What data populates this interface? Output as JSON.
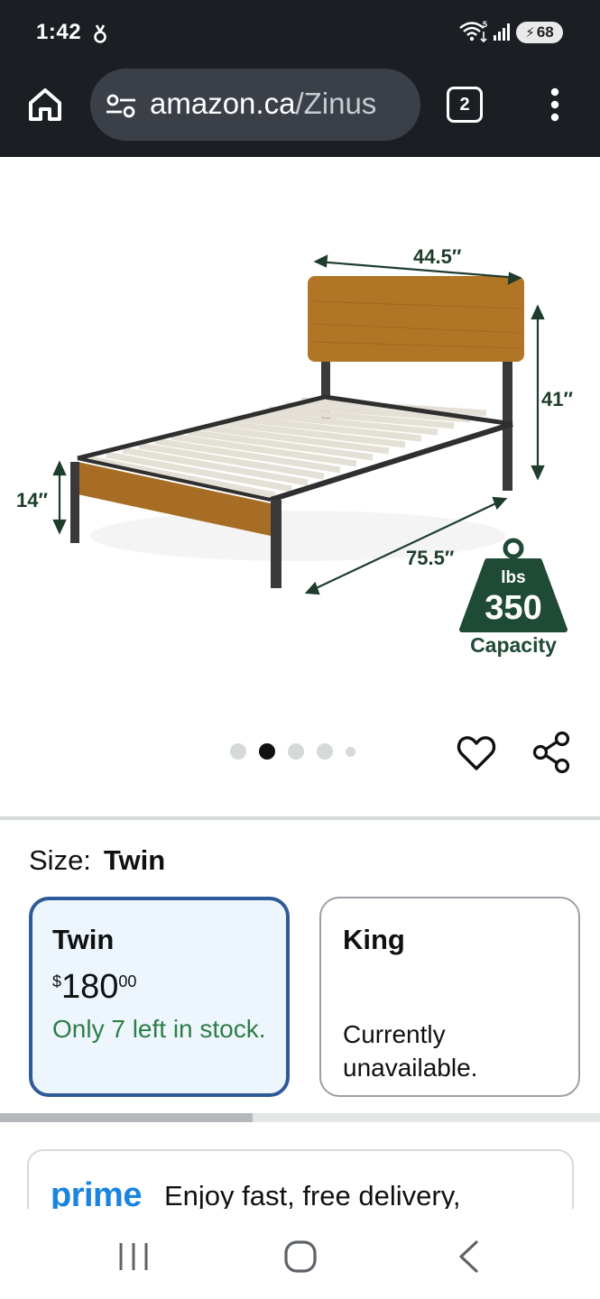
{
  "status_bar": {
    "time": "1:42",
    "battery": "68",
    "icons": [
      "notification-icon",
      "wifi-icon",
      "signal-icon",
      "battery-icon"
    ]
  },
  "browser": {
    "url_domain": "amazon.ca",
    "url_path": "/Zinus",
    "tab_count": "2",
    "icons": [
      "home-icon",
      "site-settings-icon",
      "tab-switcher-icon",
      "more-vert-icon"
    ]
  },
  "product_image": {
    "dim_width": "44.5″",
    "dim_height": "41″",
    "dim_clearance": "14″",
    "dim_length": "75.5″",
    "capacity_unit": "lbs",
    "capacity_value": "350",
    "capacity_label": "Capacity",
    "image_count": 5,
    "active_image": 2
  },
  "actions": {
    "icons": [
      "heart-icon",
      "share-icon"
    ]
  },
  "size_selector": {
    "label": "Size:",
    "selected_value": "Twin",
    "options": [
      {
        "name": "Twin",
        "currency_symbol": "$",
        "price_whole": "180",
        "price_fraction": "00",
        "stock": "Only 7 left in stock."
      },
      {
        "name": "King",
        "availability": "Currently unavailable."
      }
    ]
  },
  "prime": {
    "logo": "prime",
    "text": "Enjoy fast, free delivery,"
  },
  "colors": {
    "selected_border": "#2e5a98",
    "selected_bg": "#edf5fd",
    "stock_green": "#2f7e47",
    "prime_blue": "#1a84de",
    "badge_green": "#1f4a36"
  },
  "nav_bar": {
    "icons": [
      "recents-icon",
      "home-nav-icon",
      "back-icon"
    ]
  }
}
